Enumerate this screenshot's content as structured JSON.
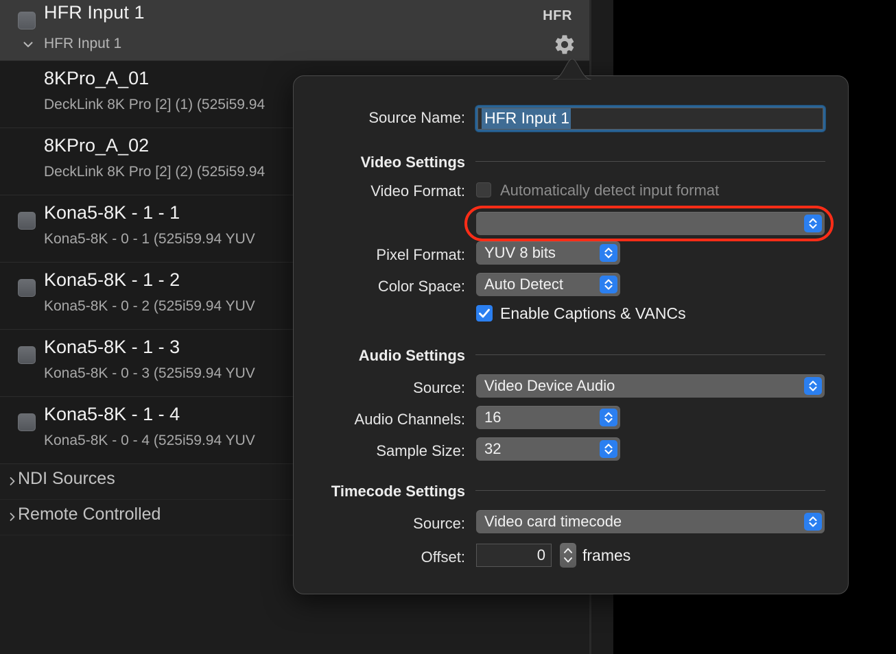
{
  "sidebar": {
    "group": {
      "title": "HFR Input 1",
      "badge": "HFR",
      "subtitle": "HFR Input 1",
      "checkbox_checked": false,
      "expanded": true,
      "gear_icon": "gear-icon",
      "disclosure_icon": "chevron-down-icon"
    },
    "sources": [
      {
        "name": "8KPro_A_01",
        "description": "DeckLink 8K Pro [2] (1) (525i59.94",
        "has_checkbox": false,
        "checked": false
      },
      {
        "name": "8KPro_A_02",
        "description": "DeckLink 8K Pro [2] (2) (525i59.94",
        "has_checkbox": false,
        "checked": false
      },
      {
        "name": "Kona5-8K - 1 - 1",
        "description": "Kona5-8K - 0 - 1 (525i59.94 YUV",
        "has_checkbox": true,
        "checked": false
      },
      {
        "name": "Kona5-8K - 1 - 2",
        "description": "Kona5-8K - 0 - 2 (525i59.94 YUV",
        "has_checkbox": true,
        "checked": false
      },
      {
        "name": "Kona5-8K - 1 - 3",
        "description": "Kona5-8K - 0 - 3 (525i59.94 YUV",
        "has_checkbox": true,
        "checked": false
      },
      {
        "name": "Kona5-8K - 1 - 4",
        "description": "Kona5-8K - 0 - 4 (525i59.94 YUV",
        "has_checkbox": true,
        "checked": false
      }
    ],
    "collapsed_sections": [
      {
        "label": "NDI Sources",
        "icon": "chevron-right-icon"
      },
      {
        "label": "Remote Controlled",
        "icon": "chevron-right-icon"
      }
    ]
  },
  "popover": {
    "source_name": {
      "label": "Source Name:",
      "value": "HFR Input 1",
      "selected": true
    },
    "video_settings": {
      "title": "Video Settings",
      "video_format_label": "Video Format:",
      "auto_detect_label": "Automatically detect input format",
      "auto_detect_checked": false,
      "auto_detect_enabled": false,
      "video_format_value": "",
      "video_format_highlighted": true,
      "pixel_format_label": "Pixel Format:",
      "pixel_format_value": "YUV 8 bits",
      "color_space_label": "Color Space:",
      "color_space_value": "Auto Detect",
      "captions_label": "Enable Captions & VANCs",
      "captions_checked": true
    },
    "audio_settings": {
      "title": "Audio Settings",
      "source_label": "Source:",
      "source_value": "Video Device Audio",
      "channels_label": "Audio Channels:",
      "channels_value": "16",
      "sample_size_label": "Sample Size:",
      "sample_size_value": "32"
    },
    "timecode_settings": {
      "title": "Timecode Settings",
      "source_label": "Source:",
      "source_value": "Video card timecode",
      "offset_label": "Offset:",
      "offset_value": "0",
      "offset_unit": "frames"
    }
  },
  "colors": {
    "accent_blue": "#2b7ff0",
    "focus_ring": "#2a6496",
    "error_red": "#ff2d17",
    "selection_blue": "#3f6c94",
    "panel_bg": "#242424",
    "sidebar_bg": "#1d1d1d",
    "row_bg": "#1b1b1b",
    "group_header_bg": "#3a3a3a",
    "control_bg": "#5f5f5f"
  }
}
